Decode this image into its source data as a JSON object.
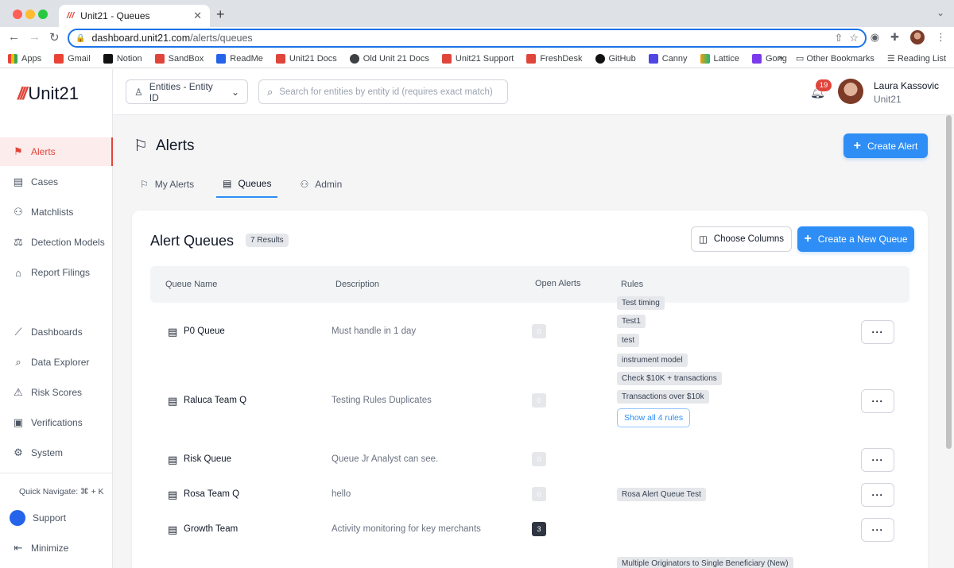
{
  "browser": {
    "tab_title": "Unit21 - Queues",
    "url_host": "dashboard.unit21.com",
    "url_path": "/alerts/queues",
    "bookmarks": [
      "Apps",
      "Gmail",
      "Notion",
      "SandBox",
      "ReadMe",
      "Unit21 Docs",
      "Old Unit 21 Docs",
      "Unit21 Support",
      "FreshDesk",
      "GitHub",
      "Canny",
      "Lattice",
      "Gong"
    ],
    "other_bookmarks": "Other Bookmarks",
    "reading_list": "Reading List"
  },
  "logo": {
    "mark": "///",
    "text": "Unit21"
  },
  "sidebar": {
    "items": [
      {
        "label": "Alerts",
        "icon": "flag-icon"
      },
      {
        "label": "Cases",
        "icon": "briefcase-icon"
      },
      {
        "label": "Matchlists",
        "icon": "user-plus-icon"
      },
      {
        "label": "Detection Models",
        "icon": "scale-icon"
      },
      {
        "label": "Report Filings",
        "icon": "building-icon"
      },
      {
        "label": "Dashboards",
        "icon": "chart-icon"
      },
      {
        "label": "Data Explorer",
        "icon": "data-search-icon"
      },
      {
        "label": "Risk Scores",
        "icon": "warning-icon"
      },
      {
        "label": "Verifications",
        "icon": "id-card-icon"
      },
      {
        "label": "System",
        "icon": "gear-icon"
      }
    ],
    "quick_navigate": "Quick Navigate:",
    "quick_navigate_keys": "⌘ + K",
    "support": "Support",
    "minimize": "Minimize"
  },
  "topbar": {
    "entity_select": "Entities - Entity ID",
    "search_placeholder": "Search for entities by entity id (requires exact match)",
    "notification_count": "19",
    "user_name": "Laura Kassovic",
    "user_org": "Unit21"
  },
  "page": {
    "title": "Alerts",
    "create_alert": "Create Alert",
    "tabs": [
      {
        "label": "My Alerts",
        "active": false
      },
      {
        "label": "Queues",
        "active": true
      },
      {
        "label": "Admin",
        "active": false
      }
    ]
  },
  "queues": {
    "title": "Alert Queues",
    "results": "7 Results",
    "choose_columns": "Choose Columns",
    "create_queue": "Create a New Queue",
    "columns": [
      "Queue Name",
      "Description",
      "Open Alerts",
      "Rules"
    ],
    "rows": [
      {
        "name": "P0 Queue",
        "description": "Must handle in 1 day",
        "open_alerts": "0",
        "rules": [
          "Test timing",
          "Test1",
          "test"
        ]
      },
      {
        "name": "Raluca Team Q",
        "description": "Testing Rules Duplicates",
        "open_alerts": "0",
        "rules": [
          "instrument model",
          "Check $10K + transactions",
          "Transactions over $10k"
        ],
        "show_all": "Show all 4 rules"
      },
      {
        "name": "Risk Queue",
        "description": "Queue Jr Analyst can see.",
        "open_alerts": "0",
        "rules": []
      },
      {
        "name": "Rosa Team Q",
        "description": "hello",
        "open_alerts": "0",
        "rules": [
          "Rosa Alert Queue Test"
        ]
      },
      {
        "name": "Growth Team",
        "description": "Activity monitoring for key merchants",
        "open_alerts": "3",
        "rules": []
      },
      {
        "name": "",
        "description": "",
        "open_alerts": "",
        "rules": [
          "Multiple Originators to Single Beneficiary (New)"
        ]
      }
    ]
  },
  "colors": {
    "accent": "#2e8ef5",
    "brand": "#e0453b",
    "badge": "#e0453b"
  }
}
